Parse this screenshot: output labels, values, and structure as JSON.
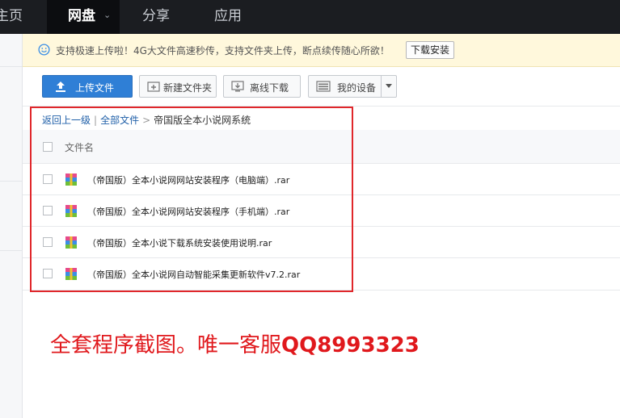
{
  "topnav": {
    "home": "主页",
    "disk": "网盘",
    "share": "分享",
    "apps": "应用"
  },
  "notice": {
    "text": "支持极速上传啦！4G大文件高速秒传，支持文件夹上传，断点续传随心所欲！",
    "download_button": "下载安装"
  },
  "toolbar": {
    "upload": "上传文件",
    "new_folder": "新建文件夹",
    "offline": "离线下载",
    "my_device": "我的设备"
  },
  "breadcrumb": {
    "back": "返回上一级",
    "all_files": "全部文件",
    "current": "帝国版全本小说网系统"
  },
  "file_list": {
    "column_name": "文件名",
    "files": [
      {
        "name": "（帝国版）全本小说网网站安装程序（电脑端）.rar"
      },
      {
        "name": "（帝国版）全本小说网网站安装程序（手机端）.rar"
      },
      {
        "name": "（帝国版）全本小说下载系统安装使用说明.rar"
      },
      {
        "name": "（帝国版）全本小说网自动智能采集更新软件v7.2.rar"
      }
    ]
  },
  "caption": {
    "text": "全套程序截图。唯一客服",
    "qq": "QQ8993323"
  },
  "colors": {
    "accent": "#2f7fd6",
    "highlight": "#e0272b",
    "caption": "#e0181c"
  }
}
